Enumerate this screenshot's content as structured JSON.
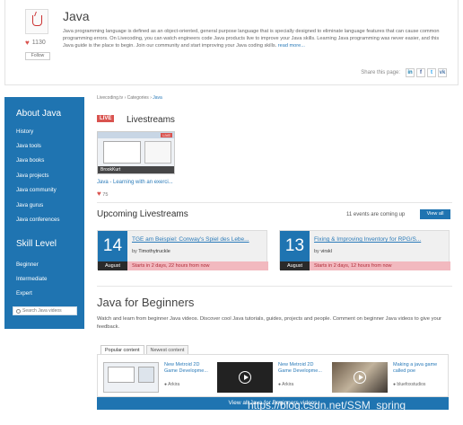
{
  "header": {
    "title": "Java",
    "likes": "1130",
    "follow_label": "Follow",
    "description": "Java programming language is defined as an object-oriented, general purpose language that is specially designed to eliminate language features that can cause common programming errors. On Livecoding, you can watch engineers code Java products live to improve your Java skills. Learning Java programming was never easier, and this Java guide is the place to begin. Join our community and start improving your Java coding skills.",
    "read_more": "read more...",
    "share_label": "Share this page:",
    "share_icons": [
      "linkedin-icon",
      "facebook-icon",
      "twitter-icon",
      "vk-icon"
    ]
  },
  "sidebar": {
    "about_heading": "About Java",
    "about_items": [
      "History",
      "Java tools",
      "Java books",
      "Java projects",
      "Java community",
      "Java gurus",
      "Java conferences"
    ],
    "skill_heading": "Skill Level",
    "skill_items": [
      "Beginner",
      "Intermediate",
      "Expert"
    ],
    "search_placeholder": "Search Java videos"
  },
  "breadcrumb": {
    "text": "Livecoding.tv › Categories ›",
    "current": "Java"
  },
  "livestreams": {
    "badge": "LIVE",
    "title": "Livestreams",
    "stream": {
      "user": "BrookKurt",
      "link": "Java - Learning with an exerci...",
      "likes": "75",
      "thumb_live": "LIVE"
    }
  },
  "upcoming": {
    "title": "Upcoming Livestreams",
    "count_text": "11 events are coming up",
    "view_all": "View all",
    "events": [
      {
        "day": "14",
        "month": "August",
        "title": "TGE am Beispiel: Conway's Spiel des Lebe...",
        "by": "by",
        "author": "Timothytruckle",
        "starts_prefix": "Starts in",
        "starts": "2 days, 22 hours from now"
      },
      {
        "day": "13",
        "month": "August",
        "title": "Fixing & Improving Inventory for RPG/S...",
        "by": "by",
        "author": "virskl",
        "starts_prefix": "Starts in",
        "starts": "2 days, 12 hours from now"
      }
    ]
  },
  "beginners": {
    "title": "Java for Beginners",
    "description": "Watch and learn from beginner Java videos. Discover cool Java tutorials, guides, projects and people. Comment on beginner Java videos to give your feedback.",
    "tabs": [
      "Popular content",
      "Newest content"
    ],
    "videos": [
      {
        "title": "New Metroid 2D Game Developme...",
        "author": "Arkira"
      },
      {
        "title": "New Metroid 2D Game Developme...",
        "author": "Arkira"
      },
      {
        "title": "Making a java game called poe",
        "author": "bluefoxstudios"
      }
    ],
    "view_more": "View all Java for Beginners videos"
  },
  "watermark": "https://blog.csdn.net/SSM_spring",
  "colors": {
    "primary_blue": "#1f74b1",
    "live_red": "#d9534f",
    "link_blue": "#2b7bb9",
    "starts_pink": "#f2b9bf",
    "month_dark": "#2a2a2a"
  }
}
